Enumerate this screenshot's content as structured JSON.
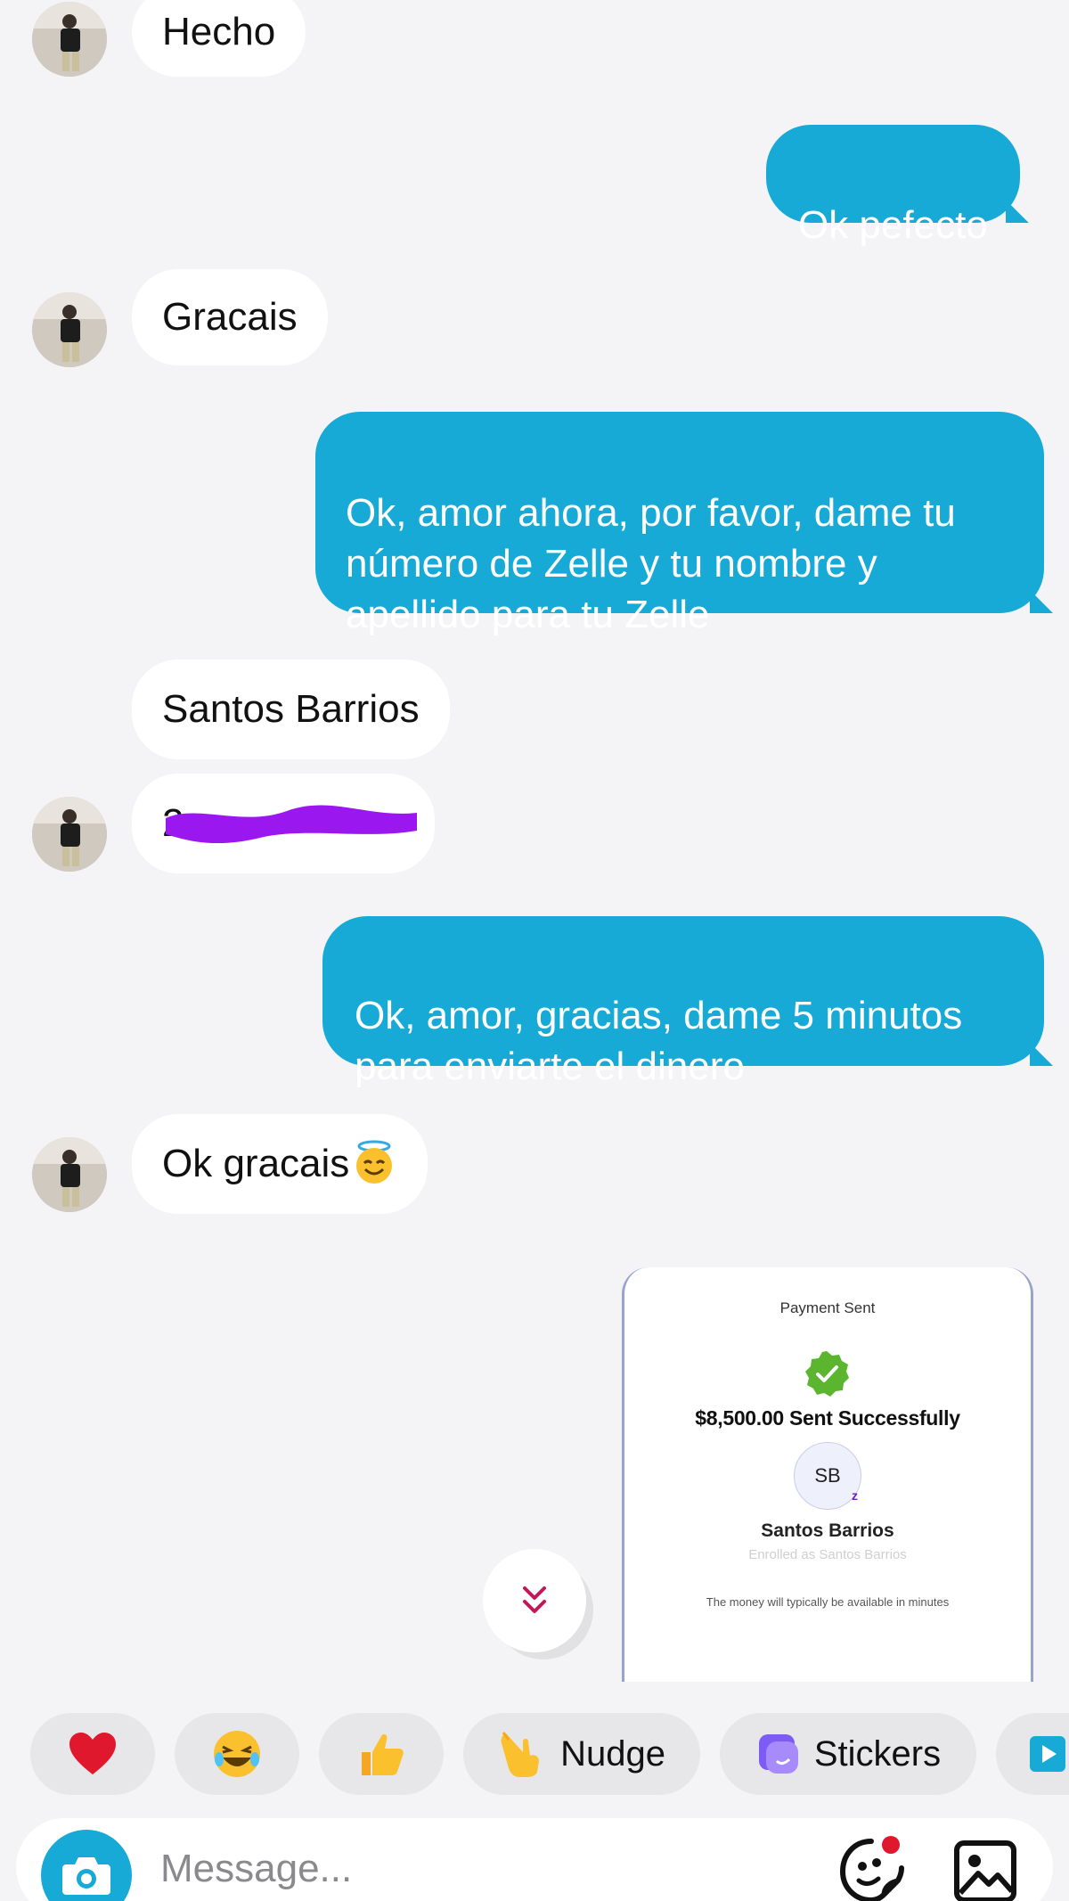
{
  "conversation": {
    "messages": [
      {
        "direction": "incoming",
        "text": "Hecho"
      },
      {
        "direction": "outgoing",
        "text": "Ok pefecto"
      },
      {
        "direction": "incoming",
        "text": "Gracais"
      },
      {
        "direction": "outgoing",
        "text": "Ok, amor ahora, por favor, dame tu\nnúmero de Zelle y tu nombre y\napellido para tu Zelle"
      },
      {
        "direction": "incoming",
        "text": "Santos Barrios"
      },
      {
        "direction": "incoming",
        "text": "2",
        "note_redacted": true
      },
      {
        "direction": "outgoing",
        "text": "Ok, amor, gracias, dame 5 minutos\npara enviarte el dinero"
      },
      {
        "direction": "incoming",
        "text": "Ok gracais",
        "emoji": "smiling-face-with-halo"
      }
    ],
    "payment_card": {
      "title": "Payment Sent",
      "amount": "$8,500.00 Sent Successfully",
      "initials": "SB",
      "badge": "z",
      "name": "Santos Barrios",
      "enrolled": "Enrolled as Santos Barrios",
      "note": "The money will typically be available in minutes"
    }
  },
  "reactions": [
    {
      "icon": "heart-icon",
      "label": ""
    },
    {
      "icon": "laughing-face-icon",
      "label": ""
    },
    {
      "icon": "thumbs-up-icon",
      "label": ""
    },
    {
      "icon": "pointing-hand-icon",
      "label": "Nudge"
    },
    {
      "icon": "stickers-icon",
      "label": "Stickers"
    },
    {
      "icon": "play-icon",
      "label": ""
    }
  ],
  "composer": {
    "placeholder": "Message..."
  },
  "colors": {
    "outgoing_bubble": "#17aad6",
    "incoming_bubble": "#ffffff",
    "background": "#f4f4f6",
    "redaction": "#9b17f0",
    "check_green": "#5bb52e"
  }
}
